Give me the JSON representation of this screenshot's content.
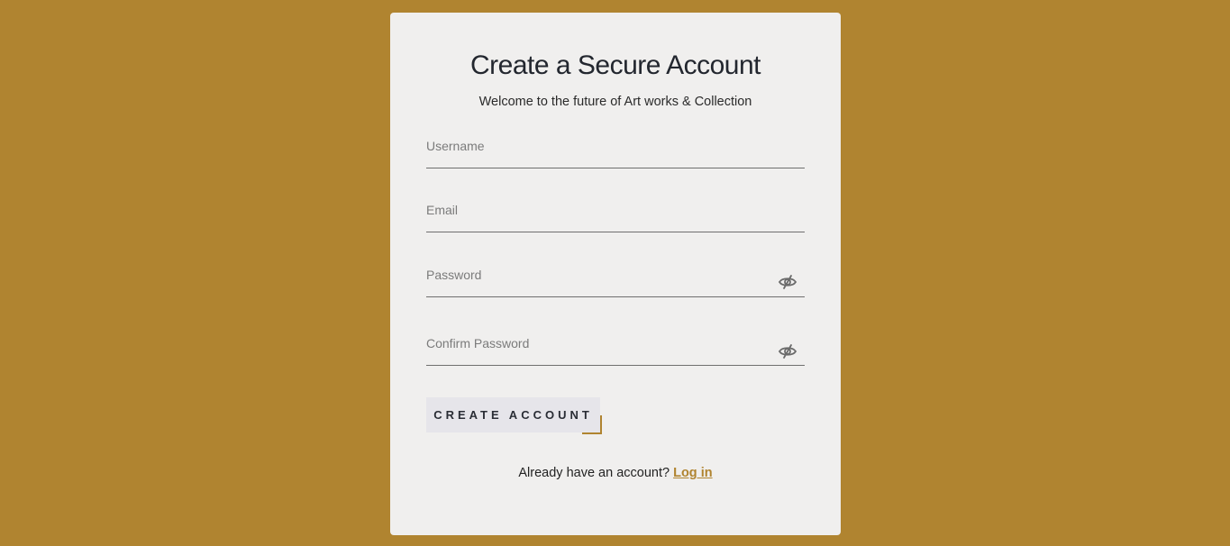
{
  "colors": {
    "background": "#b08430",
    "card": "#f0efee",
    "accent": "#b08430",
    "button_bg": "#e6e5ea"
  },
  "card": {
    "title": "Create a Secure Account",
    "subtitle": "Welcome to the future of Art works & Collection"
  },
  "form": {
    "username": {
      "placeholder": "Username",
      "value": ""
    },
    "email": {
      "placeholder": "Email",
      "value": ""
    },
    "password": {
      "placeholder": "Password",
      "value": "",
      "toggle_icon": "eye-slash-icon"
    },
    "confirm_password": {
      "placeholder": "Confirm Password",
      "value": "",
      "toggle_icon": "eye-slash-icon"
    },
    "submit_label": "CREATE ACCOUNT"
  },
  "footer": {
    "prompt": "Already have an account?",
    "login_link": "Log in"
  }
}
